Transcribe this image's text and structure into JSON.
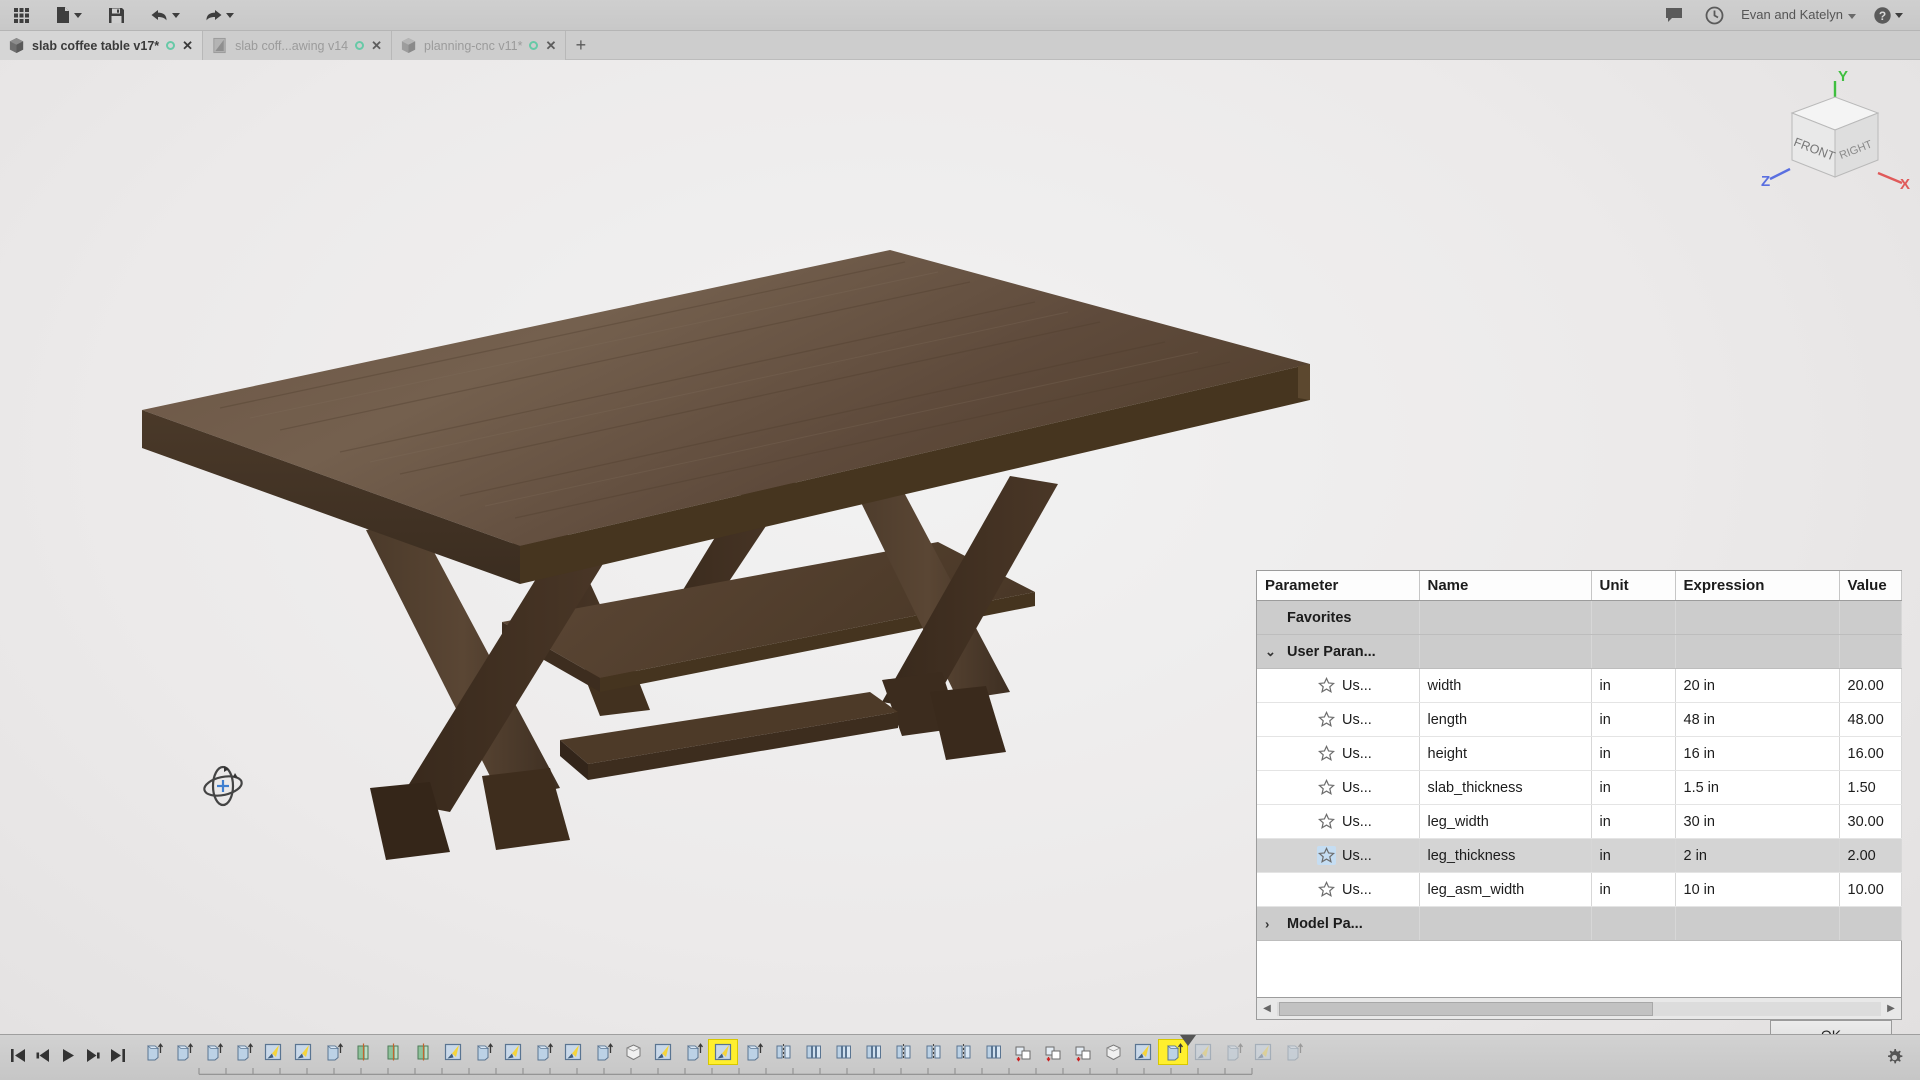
{
  "app": {
    "toolbar": {
      "grid_menu": "apps-grid-icon",
      "new_file": "new-file-icon",
      "save": "save-icon",
      "undo": "undo-icon",
      "redo": "redo-icon",
      "comments": "comment-icon",
      "history": "clock-icon",
      "user_name": "Evan and Katelyn",
      "help": "help-icon"
    },
    "tabs": [
      {
        "label": "slab coffee table v17*",
        "icon": "design-doc-icon",
        "active": true,
        "sync": "sync-pending-icon",
        "close": "✕"
      },
      {
        "label": "slab coff...awing v14",
        "icon": "drawing-doc-icon",
        "active": false,
        "sync": "sync-pending-icon",
        "close": "✕"
      },
      {
        "label": "planning-cnc v11*",
        "icon": "design-doc-icon",
        "active": false,
        "sync": "sync-pending-icon",
        "close": "✕"
      }
    ],
    "new_tab_label": "+"
  },
  "viewport": {
    "view_cube": {
      "front_face": "FRONT",
      "right_face": "RIGHT",
      "axis_x": "X",
      "axis_y": "Y",
      "axis_z": "Z",
      "axis_x_color": "#e05a5a",
      "axis_y_color": "#3fbf3f",
      "axis_z_color": "#5a6fe0"
    },
    "cursor": "orbit-cursor-icon",
    "model_name": "slab coffee table"
  },
  "parameters_dialog": {
    "columns": [
      "Parameter",
      "Name",
      "Unit",
      "Expression",
      "Value"
    ],
    "rows": [
      {
        "kind": "group",
        "parameter": "Favorites",
        "twisty": "",
        "name": "",
        "unit": "",
        "expression": "",
        "value": ""
      },
      {
        "kind": "group",
        "parameter": "User Paran...",
        "twisty": "⌄",
        "name": "",
        "unit": "",
        "expression": "",
        "value": ""
      },
      {
        "kind": "param",
        "parameter": "Us...",
        "name": "width",
        "unit": "in",
        "expression": "20 in",
        "value": "20.00",
        "favorite": false,
        "selected": false
      },
      {
        "kind": "param",
        "parameter": "Us...",
        "name": "length",
        "unit": "in",
        "expression": "48 in",
        "value": "48.00",
        "favorite": false,
        "selected": false
      },
      {
        "kind": "param",
        "parameter": "Us...",
        "name": "height",
        "unit": "in",
        "expression": "16 in",
        "value": "16.00",
        "favorite": false,
        "selected": false
      },
      {
        "kind": "param",
        "parameter": "Us...",
        "name": "slab_thickness",
        "unit": "in",
        "expression": "1.5 in",
        "value": "1.50",
        "favorite": false,
        "selected": false
      },
      {
        "kind": "param",
        "parameter": "Us...",
        "name": "leg_width",
        "unit": "in",
        "expression": "30 in",
        "value": "30.00",
        "favorite": false,
        "selected": false
      },
      {
        "kind": "param",
        "parameter": "Us...",
        "name": "leg_thickness",
        "unit": "in",
        "expression": "2 in",
        "value": "2.00",
        "favorite": false,
        "selected": true
      },
      {
        "kind": "param",
        "parameter": "Us...",
        "name": "leg_asm_width",
        "unit": "in",
        "expression": "10 in",
        "value": "10.00",
        "favorite": false,
        "selected": false
      },
      {
        "kind": "group",
        "parameter": "Model Pa...",
        "twisty": "›",
        "name": "",
        "unit": "",
        "expression": "",
        "value": ""
      }
    ],
    "scrollbar": {
      "left_arrow": "◀",
      "right_arrow": "▶"
    },
    "ok_label": "OK"
  },
  "timeline": {
    "playback": [
      "skip-to-start-icon",
      "step-back-icon",
      "play-icon",
      "step-forward-icon",
      "skip-to-end-icon"
    ],
    "features": [
      {
        "type": "extrude-icon",
        "state": "normal"
      },
      {
        "type": "extrude-icon",
        "state": "normal"
      },
      {
        "type": "extrude-icon",
        "state": "normal"
      },
      {
        "type": "extrude-icon",
        "state": "normal"
      },
      {
        "type": "sketch-icon",
        "state": "normal"
      },
      {
        "type": "sketch-icon",
        "state": "normal"
      },
      {
        "type": "extrude-icon",
        "state": "normal"
      },
      {
        "type": "revolve-icon",
        "state": "normal"
      },
      {
        "type": "revolve-icon",
        "state": "normal"
      },
      {
        "type": "revolve-icon",
        "state": "normal"
      },
      {
        "type": "sketch-icon",
        "state": "normal"
      },
      {
        "type": "extrude-icon",
        "state": "normal"
      },
      {
        "type": "sketch-icon",
        "state": "normal"
      },
      {
        "type": "extrude-icon",
        "state": "normal"
      },
      {
        "type": "sketch-icon",
        "state": "normal"
      },
      {
        "type": "extrude-icon",
        "state": "normal"
      },
      {
        "type": "box-icon",
        "state": "normal"
      },
      {
        "type": "sketch-icon",
        "state": "normal"
      },
      {
        "type": "extrude-icon",
        "state": "normal"
      },
      {
        "type": "sketch-icon",
        "state": "highlighted"
      },
      {
        "type": "extrude-icon",
        "state": "normal"
      },
      {
        "type": "mirror-icon",
        "state": "normal"
      },
      {
        "type": "pattern-icon",
        "state": "normal"
      },
      {
        "type": "pattern-icon",
        "state": "normal"
      },
      {
        "type": "pattern-icon",
        "state": "normal"
      },
      {
        "type": "mirror-icon",
        "state": "normal"
      },
      {
        "type": "mirror-icon",
        "state": "normal"
      },
      {
        "type": "mirror-icon",
        "state": "normal"
      },
      {
        "type": "pattern-icon",
        "state": "normal"
      },
      {
        "type": "combine-icon",
        "state": "normal"
      },
      {
        "type": "combine-icon",
        "state": "normal"
      },
      {
        "type": "combine-icon",
        "state": "normal"
      },
      {
        "type": "box-icon",
        "state": "normal"
      },
      {
        "type": "sketch-icon",
        "state": "normal"
      },
      {
        "type": "extrude-icon",
        "state": "highlighted"
      },
      {
        "type": "sketch-icon",
        "state": "dimmed"
      },
      {
        "type": "extrude-icon",
        "state": "dimmed"
      },
      {
        "type": "sketch-icon",
        "state": "dimmed"
      },
      {
        "type": "extrude-icon",
        "state": "dimmed"
      }
    ],
    "settings": "gear-icon"
  }
}
